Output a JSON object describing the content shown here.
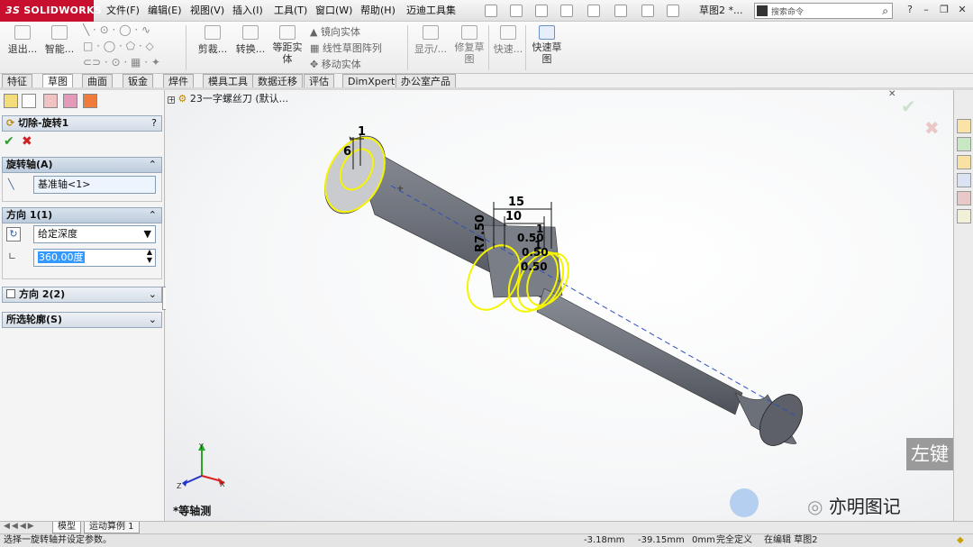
{
  "app": {
    "logo_prefix": "3S",
    "logo": "SOLIDWORKS",
    "document_title": "草图2 *..."
  },
  "menu": [
    {
      "label": "文件(F)"
    },
    {
      "label": "编辑(E)"
    },
    {
      "label": "视图(V)"
    },
    {
      "label": "插入(I)"
    },
    {
      "label": "工具(T)"
    },
    {
      "label": "窗口(W)"
    },
    {
      "label": "帮助(H)"
    },
    {
      "label": "迈迪工具集"
    }
  ],
  "search": {
    "placeholder": "搜索命令"
  },
  "command_manager": {
    "exit_sketch": "退出...",
    "smart_dimension": "智能...",
    "trim": "剪裁...",
    "convert": "转换...",
    "offset_line1": "等距实",
    "offset_line2": "体",
    "mirror": "镜向实体",
    "linear_pattern": "线性草图阵列",
    "move": "移动实体",
    "display": "显示/...",
    "repair_line1": "修复草",
    "repair_line2": "图",
    "quick_snaps": "快速...",
    "rapid_sketch_line1": "快速草",
    "rapid_sketch_line2": "图"
  },
  "tabs": [
    {
      "label": "特征"
    },
    {
      "label": "草图"
    },
    {
      "label": "曲面"
    },
    {
      "label": "钣金"
    },
    {
      "label": "焊件"
    },
    {
      "label": "模具工具"
    },
    {
      "label": "数据迁移"
    },
    {
      "label": "评估"
    },
    {
      "label": "DimXpert"
    },
    {
      "label": "办公室产品"
    }
  ],
  "property_manager": {
    "title": "切除-旋转1",
    "help": "?",
    "axis_section": "旋转轴(A)",
    "axis_value": "基准轴<1>",
    "direction1_section": "方向 1(1)",
    "end_condition": "给定深度",
    "angle": "360.00度",
    "direction2_section": "方向 2(2)",
    "contours_section": "所选轮廓(S)"
  },
  "feature_tree": {
    "text": "23一字螺丝刀  (默认..."
  },
  "dimensions": {
    "d1": "1",
    "d6": "6",
    "d15": "15",
    "d10": "10",
    "dR": "R7.50",
    "d05a": "0.50",
    "d05b": "0.50",
    "d05c": "0.50",
    "d1b": "1",
    "d1c": "1"
  },
  "triad": {
    "x": "X",
    "y": "Y",
    "z": "Z"
  },
  "view_name": "*等轴测",
  "watermark": {
    "hint": "左键",
    "brand": "亦明图记"
  },
  "bottom_tabs": [
    {
      "label": "模型"
    },
    {
      "label": "运动算例 1"
    }
  ],
  "status": {
    "message": "选择一旋转轴并设定参数。",
    "x": "-3.18mm",
    "y": "-39.15mm",
    "z": "0mm",
    "state": "完全定义",
    "editing": "在编辑 草图2"
  },
  "colors": {
    "accent": "#c8102e",
    "selection": "#f5f500",
    "body": "#6f737c"
  }
}
